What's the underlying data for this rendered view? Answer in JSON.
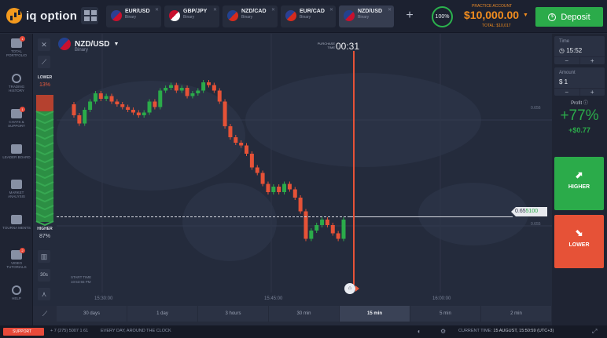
{
  "app": {
    "logo_text": "iq option"
  },
  "tabs": [
    {
      "pair": "EUR/USD",
      "type": "Binary",
      "flag_a": "#2b3f93",
      "flag_b": "#c8102e",
      "active": false
    },
    {
      "pair": "GBP/JPY",
      "type": "Binary",
      "flag_a": "#c8102e",
      "flag_b": "#ffffff",
      "active": false
    },
    {
      "pair": "NZD/CAD",
      "type": "Binary",
      "flag_a": "#23418e",
      "flag_b": "#d52b1e",
      "active": false
    },
    {
      "pair": "EUR/CAD",
      "type": "Binary",
      "flag_a": "#2b3f93",
      "flag_b": "#d52b1e",
      "active": false
    },
    {
      "pair": "NZD/USD",
      "type": "Binary",
      "flag_a": "#23418e",
      "flag_b": "#c8102e",
      "active": true
    }
  ],
  "header": {
    "circle_pct": "100%",
    "practice_label": "PRACTICE ACCOUNT",
    "balance": "$10,000.00",
    "total": "TOTAL: $10,017",
    "deposit_label": "Deposit"
  },
  "leftnav": [
    {
      "name": "total-portfolio",
      "label": "TOTAL PORTFOLIO",
      "icon": "portfolio-icon",
      "badge": "1"
    },
    {
      "name": "trading-history",
      "label": "TRADING HISTORY",
      "icon": "history-icon",
      "badge": ""
    },
    {
      "name": "chats-support",
      "label": "CHATS & SUPPORT",
      "icon": "chat-icon",
      "badge": "1"
    },
    {
      "name": "leaderboard",
      "label": "LEADER BOARD",
      "icon": "leaderboard-icon",
      "badge": ""
    },
    {
      "name": "market-analysis",
      "label": "MARKET ANALYSIS",
      "icon": "analysis-icon",
      "badge": ""
    },
    {
      "name": "tournaments",
      "label": "TOURNA MENTS",
      "icon": "trophy-icon",
      "badge": ""
    },
    {
      "name": "video-tutorials",
      "label": "VIDEO TUTORIALS",
      "icon": "video-icon",
      "badge": "2"
    },
    {
      "name": "help",
      "label": "HELP",
      "icon": "help-icon",
      "badge": ""
    }
  ],
  "chart": {
    "pair": "NZD/USD",
    "type": "Binary",
    "timer_label": "PURCHASE TIME",
    "timer": "00:31",
    "lower_label": "LOWER",
    "lower_pct": "13%",
    "higher_label": "HIGHER",
    "higher_pct": "87%",
    "tool_30s": "30s",
    "price_tag_prefix": "0.65",
    "price_tag_hi": "5100",
    "level_top": "0.656",
    "level_bottom": "0.655",
    "start_marker": "START TIME 10:53:55 PM",
    "time_labels": [
      "15:30:00",
      "15:45:00",
      "16:00:00"
    ],
    "candles": [
      {
        "o": 0.6565,
        "c": 0.6561
      },
      {
        "o": 0.6561,
        "c": 0.6558
      },
      {
        "o": 0.6558,
        "c": 0.6563
      },
      {
        "o": 0.6563,
        "c": 0.6566
      },
      {
        "o": 0.6566,
        "c": 0.6569
      },
      {
        "o": 0.6569,
        "c": 0.6567
      },
      {
        "o": 0.6567,
        "c": 0.6568
      },
      {
        "o": 0.6568,
        "c": 0.6566
      },
      {
        "o": 0.6566,
        "c": 0.6565
      },
      {
        "o": 0.6565,
        "c": 0.6564
      },
      {
        "o": 0.6564,
        "c": 0.6563
      },
      {
        "o": 0.6563,
        "c": 0.6562
      },
      {
        "o": 0.6562,
        "c": 0.6561
      },
      {
        "o": 0.6561,
        "c": 0.6562
      },
      {
        "o": 0.6562,
        "c": 0.6566
      },
      {
        "o": 0.6566,
        "c": 0.6564
      },
      {
        "o": 0.6564,
        "c": 0.657
      },
      {
        "o": 0.657,
        "c": 0.6571
      },
      {
        "o": 0.6571,
        "c": 0.6572
      },
      {
        "o": 0.6572,
        "c": 0.657
      },
      {
        "o": 0.657,
        "c": 0.6571
      },
      {
        "o": 0.6571,
        "c": 0.6568
      },
      {
        "o": 0.6568,
        "c": 0.6569
      },
      {
        "o": 0.6569,
        "c": 0.657
      },
      {
        "o": 0.657,
        "c": 0.6573
      },
      {
        "o": 0.6573,
        "c": 0.6572
      },
      {
        "o": 0.6572,
        "c": 0.657
      },
      {
        "o": 0.657,
        "c": 0.6566
      },
      {
        "o": 0.6566,
        "c": 0.6557
      },
      {
        "o": 0.6557,
        "c": 0.6553
      },
      {
        "o": 0.6553,
        "c": 0.6551
      },
      {
        "o": 0.6551,
        "c": 0.655
      },
      {
        "o": 0.655,
        "c": 0.6547
      },
      {
        "o": 0.6547,
        "c": 0.6542
      },
      {
        "o": 0.6542,
        "c": 0.654
      },
      {
        "o": 0.654,
        "c": 0.6536
      },
      {
        "o": 0.6536,
        "c": 0.6533
      },
      {
        "o": 0.6533,
        "c": 0.6535
      },
      {
        "o": 0.6535,
        "c": 0.6533
      },
      {
        "o": 0.6533,
        "c": 0.6536
      },
      {
        "o": 0.6536,
        "c": 0.6534
      },
      {
        "o": 0.6534,
        "c": 0.6531
      },
      {
        "o": 0.6531,
        "c": 0.6526
      },
      {
        "o": 0.6526,
        "c": 0.6516
      },
      {
        "o": 0.6516,
        "c": 0.6519
      },
      {
        "o": 0.6519,
        "c": 0.6521
      },
      {
        "o": 0.6521,
        "c": 0.6523
      },
      {
        "o": 0.6523,
        "c": 0.6521
      },
      {
        "o": 0.6521,
        "c": 0.6518
      },
      {
        "o": 0.6518,
        "c": 0.6516
      },
      {
        "o": 0.6516,
        "c": 0.6523
      }
    ],
    "current_price": 0.6524,
    "ylim": [
      0.6505,
      0.6585
    ]
  },
  "timeframes": [
    "30 days",
    "1 day",
    "3 hours",
    "30 min",
    "15 min",
    "5 min",
    "2 min"
  ],
  "active_timeframe": "15 min",
  "rightpanel": {
    "time_label": "Time",
    "time_value": "15:52",
    "amount_label": "Amount",
    "amount_value": "$ 1",
    "profit_label": "Profit",
    "profit_pct": "+77%",
    "profit_amt": "+$0.77",
    "higher_label": "HIGHER",
    "lower_label": "LOWER"
  },
  "footer": {
    "support": "SUPPORT",
    "phone": "+ 7 (275) 5007 1 61",
    "slogan": "EVERY DAY, AROUND THE CLOCK",
    "time_label": "CURRENT TIME:",
    "time_value": "15 AUGUST, 15:50:59 (UTC+3)"
  },
  "colors": {
    "up": "#2bab4a",
    "down": "#e65237",
    "accent": "#f08c1e"
  }
}
